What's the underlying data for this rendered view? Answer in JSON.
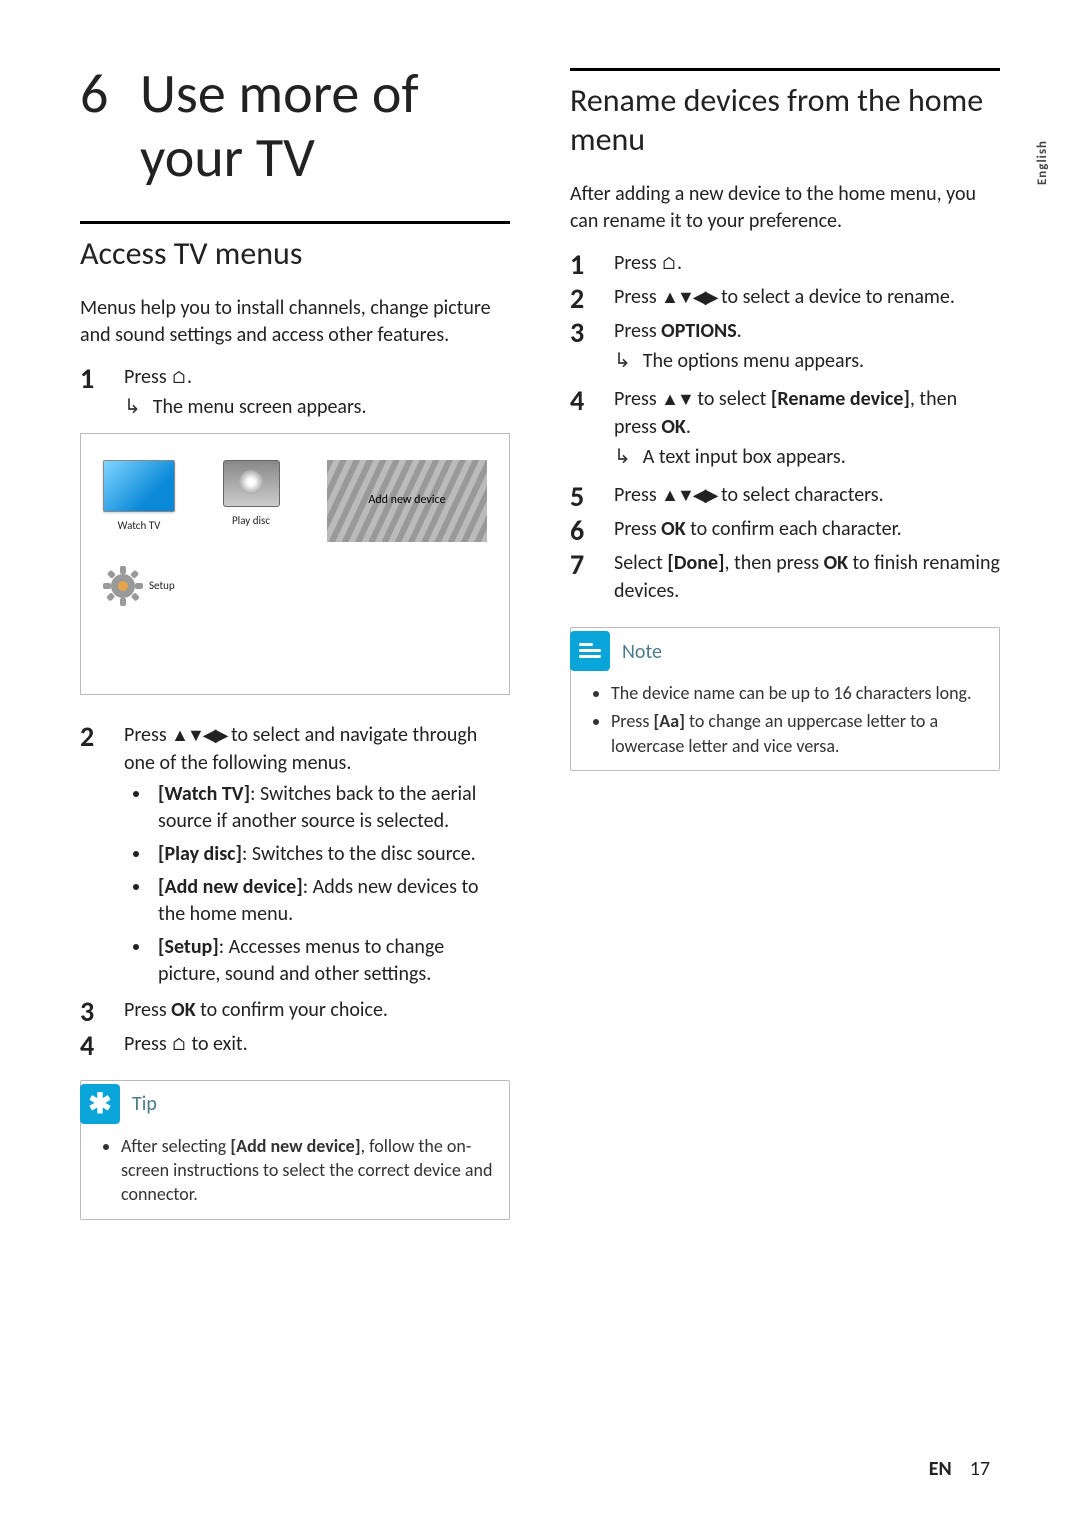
{
  "language_tab": "English",
  "chapter": {
    "number": "6",
    "title_line1": "Use more of",
    "title_line2": "your TV"
  },
  "left": {
    "section_title": "Access TV menus",
    "intro": "Menus help you to install channels, change picture and sound settings and access other features.",
    "step1_prefix": "Press ",
    "step1_suffix": ".",
    "step1_result": "The menu screen appears.",
    "diagram": {
      "watch_tv": "Watch TV",
      "play_disc": "Play disc",
      "add_new_device": "Add new device",
      "setup": "Setup"
    },
    "step2_prefix": "Press ",
    "step2_suffix": " to select and navigate through one of the following menus.",
    "options": {
      "watch_tv": {
        "label": "[Watch TV]",
        "desc": ": Switches back to the aerial source if another source is selected."
      },
      "play_disc": {
        "label": "[Play disc]",
        "desc": ": Switches to the disc source."
      },
      "add_new": {
        "label": "[Add new device]",
        "desc": ": Adds new devices to the home menu."
      },
      "setup": {
        "label": "[Setup]",
        "desc": ": Accesses menus to change picture, sound and other settings."
      }
    },
    "step3_a": "Press ",
    "step3_b": "OK",
    "step3_c": " to confirm your choice.",
    "step4_a": "Press ",
    "step4_b": " to exit.",
    "tip_title": "Tip",
    "tip_a": "After selecting ",
    "tip_b": "[Add new device]",
    "tip_c": ", follow the on-screen instructions to select the correct device and connector."
  },
  "right": {
    "section_title": "Rename devices from the home menu",
    "intro": "After adding a new device to the home menu, you can rename it to your preference.",
    "s1_a": "Press ",
    "s1_b": ".",
    "s2_a": "Press ",
    "s2_b": " to select a device to rename.",
    "s3_a": "Press ",
    "s3_b": "OPTIONS",
    "s3_c": ".",
    "s3_res": "The options menu appears.",
    "s4_a": "Press ",
    "s4_b": " to select ",
    "s4_c": "[Rename device]",
    "s4_d": ", then press ",
    "s4_e": "OK",
    "s4_f": ".",
    "s4_res": "A text input box appears.",
    "s5_a": "Press ",
    "s5_b": " to select characters.",
    "s6_a": "Press ",
    "s6_b": "OK",
    "s6_c": " to confirm each character.",
    "s7_a": "Select ",
    "s7_b": "[Done]",
    "s7_c": ", then press ",
    "s7_d": "OK",
    "s7_e": " to finish renaming devices.",
    "note_title": "Note",
    "note1": "The device name can be up to 16 characters long.",
    "note2_a": "Press ",
    "note2_b": "[Aa]",
    "note2_c": " to change an uppercase letter to a lowercase letter and vice versa."
  },
  "footer": {
    "lang": "EN",
    "page": "17"
  },
  "glyphs": {
    "home": "⌂",
    "nav4": "▲▼◀▶",
    "nav2": "▲▼"
  }
}
